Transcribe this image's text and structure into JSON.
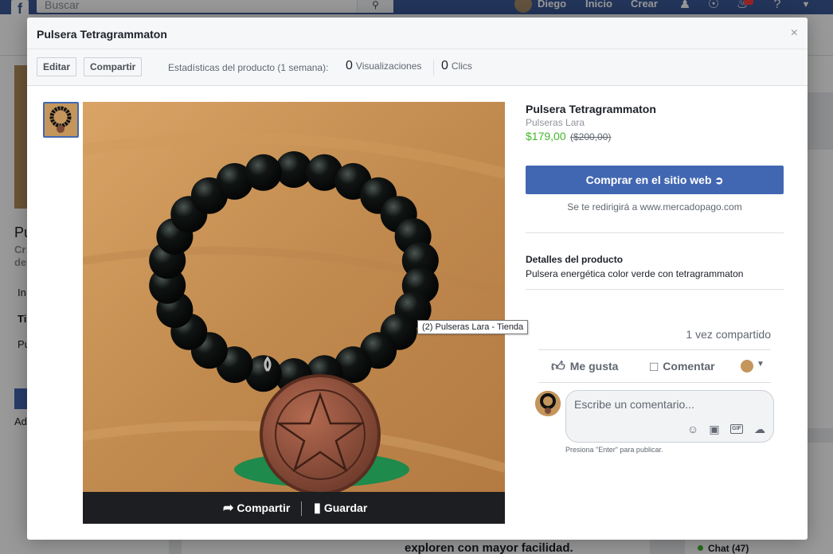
{
  "topbar": {
    "logo": "f",
    "search_placeholder": "Buscar",
    "search_icon": "search-icon",
    "user_name": "Diego",
    "nav_home": "Inicio",
    "nav_create": "Crear",
    "icons": [
      "friends-icon",
      "messenger-icon",
      "notifications-icon",
      "help-icon",
      "caret-down-icon"
    ]
  },
  "background": {
    "left_letters": [
      "Pu",
      "Cr",
      "de",
      "In",
      "Ti",
      "Pu",
      "P",
      "Ad"
    ],
    "bottom_text": "exploren con mayor facilidad.",
    "chat_label": "Chat (47)"
  },
  "modal": {
    "title": "Pulsera Tetragrammaton",
    "close_symbol": "×",
    "toolbar": {
      "edit_label": "Editar",
      "share_label": "Compartir",
      "stats_label": "Estadísticas del producto (1 semana):",
      "views_count": "0",
      "views_label": "Visualizaciones",
      "clicks_count": "0",
      "clicks_label": "Clics"
    },
    "photo_bar": {
      "share_label": "Compartir",
      "save_label": "Guardar"
    },
    "product": {
      "name": "Pulsera Tetragrammaton",
      "shop": "Pulseras Lara",
      "price": "$179,00",
      "old_price": "($200,00)",
      "buy_label": "Comprar en el sitio web",
      "redirect_text": "Se te redirigirá a www.mercadopago.com",
      "details_title": "Detalles del producto",
      "details_text": "Pulsera energética color verde con tetragrammaton"
    },
    "tooltip": "(2) Pulseras Lara - Tienda",
    "social": {
      "shares": "1 vez compartido",
      "like_label": "Me gusta",
      "comment_label": "Comentar"
    },
    "comment": {
      "placeholder": "Escribe un comentario...",
      "hint": "Presiona \"Enter\" para publicar."
    }
  },
  "colors": {
    "brand_blue": "#4267b2",
    "topbar": "#3b5998",
    "price_green": "#42b72a"
  }
}
